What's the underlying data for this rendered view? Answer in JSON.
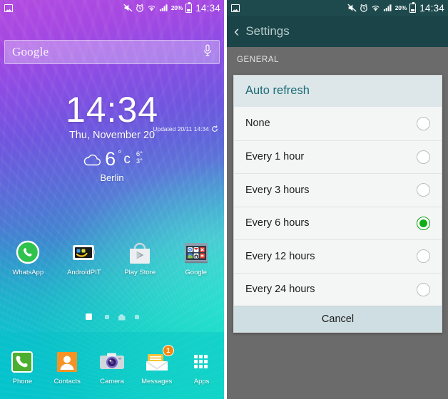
{
  "statusbar": {
    "image_icon": "image-icon",
    "mute_icon": "mute-icon",
    "alarm_icon": "alarm-icon",
    "wifi_icon": "wifi-icon",
    "signal_icon": "signal-icon",
    "battery_percent": "20%",
    "battery_icon": "battery-icon",
    "clock": "14:34"
  },
  "left": {
    "search": {
      "label": "Google",
      "mic_icon": "microphone-icon"
    },
    "widget": {
      "time": "14:34",
      "date": "Thu, November 20",
      "weather_icon": "cloud-icon",
      "temperature": "6",
      "degree": "°",
      "unit": "c",
      "high": "6°",
      "low": "3°",
      "city": "Berlin",
      "updated": "Updated 20/11 14:34",
      "refresh_icon": "refresh-icon"
    },
    "apps": [
      {
        "label": "WhatsApp",
        "icon": "whatsapp-icon"
      },
      {
        "label": "AndroidPIT",
        "icon": "androidpit-icon"
      },
      {
        "label": "Play Store",
        "icon": "play-store-icon"
      },
      {
        "label": "Google",
        "icon": "google-folder-icon"
      }
    ],
    "page_dots": [
      {
        "type": "active"
      },
      {
        "type": "dot"
      },
      {
        "type": "home"
      },
      {
        "type": "dot"
      }
    ],
    "dock": [
      {
        "label": "Phone",
        "icon": "phone-icon",
        "badge": ""
      },
      {
        "label": "Contacts",
        "icon": "contacts-icon",
        "badge": ""
      },
      {
        "label": "Camera",
        "icon": "camera-icon",
        "badge": ""
      },
      {
        "label": "Messages",
        "icon": "messages-icon",
        "badge": "1"
      },
      {
        "label": "Apps",
        "icon": "apps-grid-icon",
        "badge": ""
      }
    ]
  },
  "right": {
    "back_icon": "back-chevron-icon",
    "title": "Settings",
    "section_header": "GENERAL",
    "dialog": {
      "title": "Auto refresh",
      "options": [
        {
          "label": "None",
          "selected": false
        },
        {
          "label": "Every 1 hour",
          "selected": false
        },
        {
          "label": "Every 3 hours",
          "selected": false
        },
        {
          "label": "Every 6 hours",
          "selected": true
        },
        {
          "label": "Every 12 hours",
          "selected": false
        },
        {
          "label": "Every 24 hours",
          "selected": false
        }
      ],
      "cancel_label": "Cancel"
    }
  },
  "colors": {
    "accent_teal": "#1b6b76",
    "selected_green": "#0fae17",
    "actionbar": "#1a4447",
    "badge_orange": "#f5870d"
  }
}
